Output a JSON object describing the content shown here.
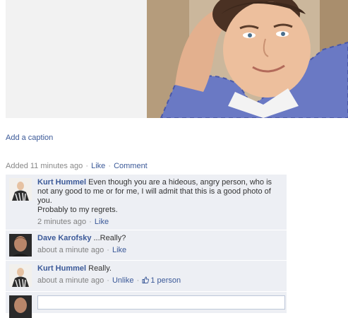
{
  "photo": {
    "add_caption_label": "Add a caption"
  },
  "meta": {
    "added_prefix": "Added",
    "added_time": "11 minutes ago",
    "like_label": "Like",
    "comment_label": "Comment",
    "separator": "·"
  },
  "comments": [
    {
      "author": "Kurt Hummel",
      "text": "Even though you are a hideous, angry person, who is not any good to me or for me, I will admit that this is a good photo of you.",
      "text2": "Probably to my regrets.",
      "time": "2 minutes ago",
      "action": "Like"
    },
    {
      "author": "Dave Karofsky",
      "text": "...Really?",
      "time": "about a minute ago",
      "action": "Like"
    },
    {
      "author": "Kurt Hummel",
      "text": "Really.",
      "time": "about a minute ago",
      "action": "Unlike",
      "likes": "1 person"
    }
  ],
  "colors": {
    "link": "#3b5998",
    "comment_bg": "#edeff4",
    "meta_gray": "#888888"
  },
  "icons": [
    "like-thumb-icon"
  ]
}
